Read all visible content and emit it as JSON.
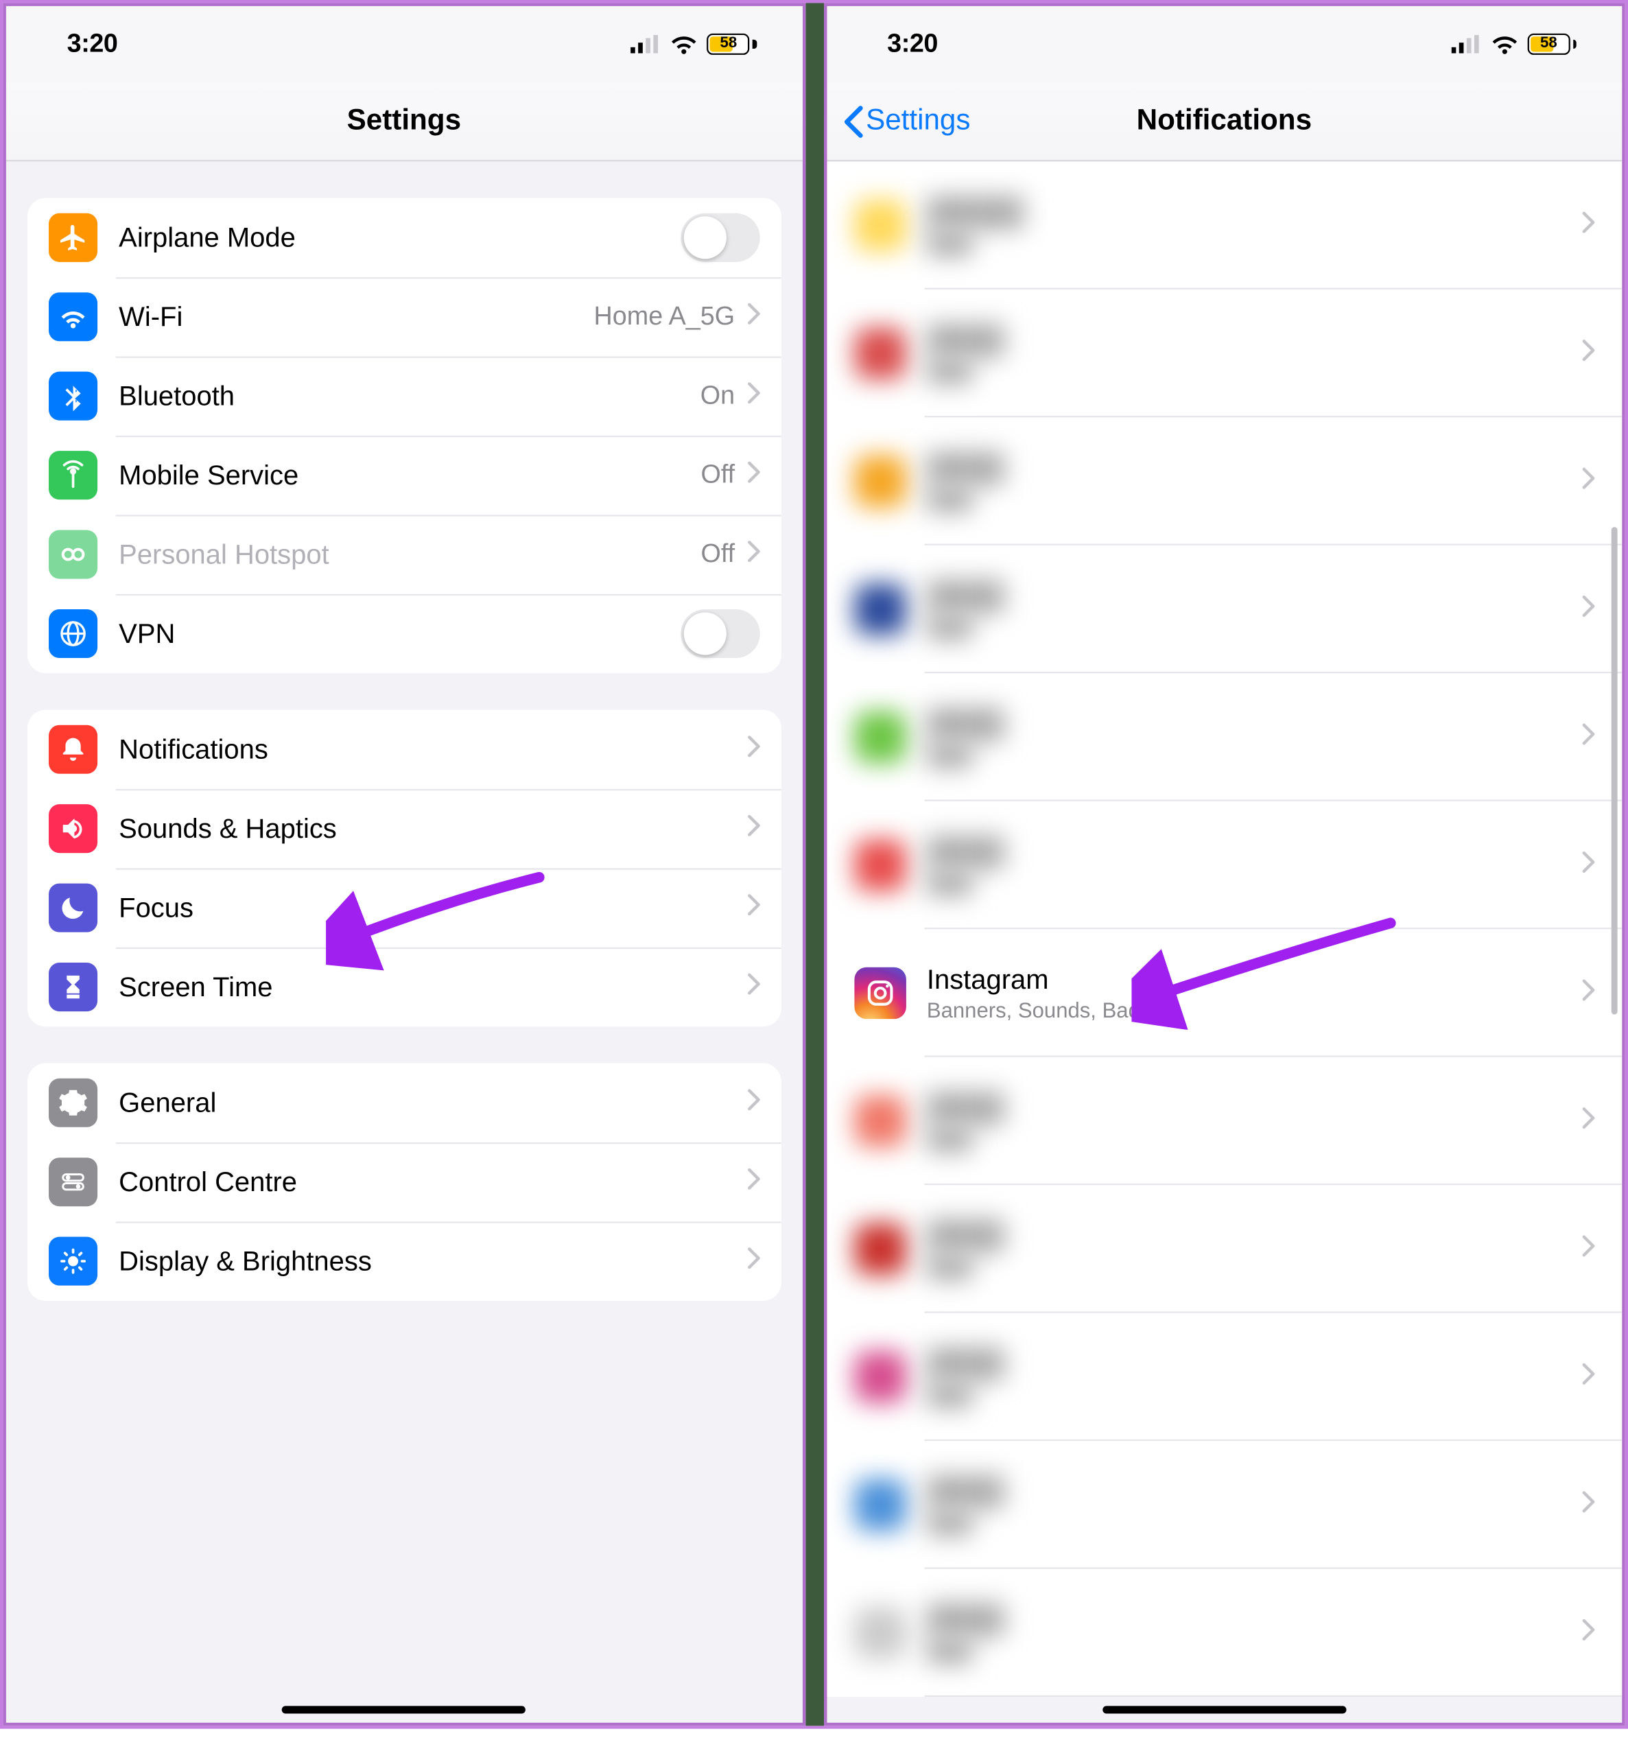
{
  "status": {
    "time": "3:20",
    "battery": "58"
  },
  "left": {
    "title": "Settings",
    "group1": [
      {
        "key": "airplane",
        "label": "Airplane Mode",
        "type": "toggle",
        "iconBg": "#ff9500"
      },
      {
        "key": "wifi",
        "label": "Wi-Fi",
        "type": "link",
        "value": "Home A_5G",
        "iconBg": "#007aff"
      },
      {
        "key": "bluetooth",
        "label": "Bluetooth",
        "type": "link",
        "value": "On",
        "iconBg": "#007aff"
      },
      {
        "key": "mobile",
        "label": "Mobile Service",
        "type": "link",
        "value": "Off",
        "iconBg": "#34c759"
      },
      {
        "key": "hotspot",
        "label": "Personal Hotspot",
        "type": "link",
        "value": "Off",
        "iconBg": "#7fd99a",
        "disabled": true
      },
      {
        "key": "vpn",
        "label": "VPN",
        "type": "toggle",
        "iconBg": "#007aff"
      }
    ],
    "group2": [
      {
        "key": "notifications",
        "label": "Notifications",
        "iconBg": "#ff3b30"
      },
      {
        "key": "sounds",
        "label": "Sounds & Haptics",
        "iconBg": "#ff2d55"
      },
      {
        "key": "focus",
        "label": "Focus",
        "iconBg": "#5856d6"
      },
      {
        "key": "screentime",
        "label": "Screen Time",
        "iconBg": "#5856d6"
      }
    ],
    "group3": [
      {
        "key": "general",
        "label": "General",
        "iconBg": "#8e8e93"
      },
      {
        "key": "controlcentre",
        "label": "Control Centre",
        "iconBg": "#8e8e93"
      },
      {
        "key": "display",
        "label": "Display & Brightness",
        "iconBg": "#0a7aff"
      }
    ]
  },
  "right": {
    "back": "Settings",
    "title": "Notifications",
    "instagram": {
      "name": "Instagram",
      "sub": "Banners, Sounds, Badges"
    }
  }
}
